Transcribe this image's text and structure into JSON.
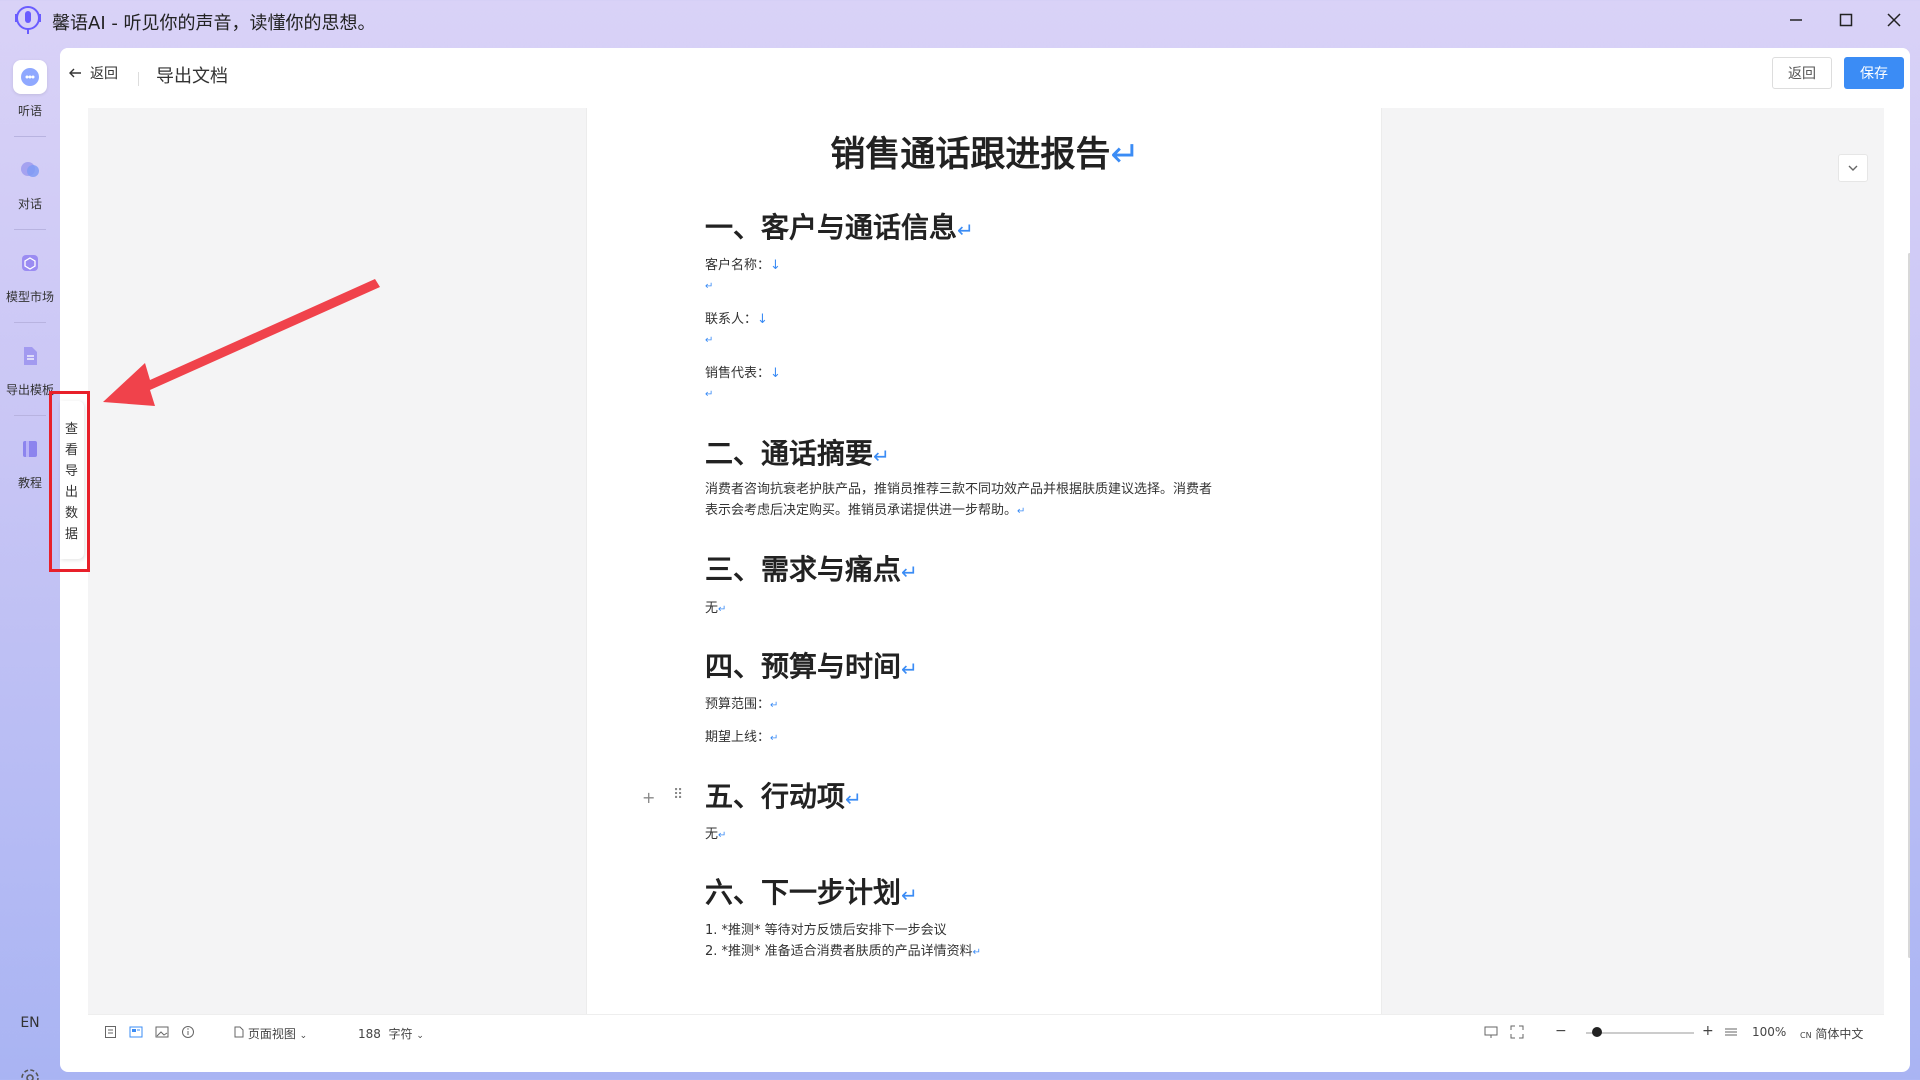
{
  "window": {
    "title": "馨语AI - 听见你的声音，读懂你的思想。",
    "min_icon": "minimize-icon",
    "max_icon": "maximize-icon",
    "close_icon": "close-icon"
  },
  "rail": {
    "items": [
      {
        "label": "听语",
        "icon": "ear-icon"
      },
      {
        "label": "对话",
        "icon": "chat-icon"
      },
      {
        "label": "模型市场",
        "icon": "cube-icon"
      },
      {
        "label": "导出模板",
        "icon": "document-icon"
      },
      {
        "label": "教程",
        "icon": "book-icon"
      }
    ],
    "lang": "EN",
    "settings_icon": "gear-icon"
  },
  "header": {
    "back_label": "返回",
    "title": "导出文档",
    "return_button": "返回",
    "save_button": "保存"
  },
  "side_tab": {
    "label": "查看导出数据"
  },
  "document": {
    "title": "销售通话跟进报告",
    "sections": {
      "s1": {
        "heading": "一、客户与通话信息",
        "customer": "客户名称：",
        "contact": "联系人：",
        "rep": "销售代表："
      },
      "s2": {
        "heading": "二、通话摘要",
        "line1": "消费者咨询抗衰老护肤产品，推销员推荐三款不同功效产品并根据肤质建议选择。消费者",
        "line2": "表示会考虑后决定购买。推销员承诺提供进一步帮助。"
      },
      "s3": {
        "heading": "三、需求与痛点",
        "body": "无"
      },
      "s4": {
        "heading": "四、预算与时间",
        "budget": "预算范围：",
        "timeline": "期望上线："
      },
      "s5": {
        "heading": "五、行动项",
        "body": "无"
      },
      "s6": {
        "heading": "六、下一步计划",
        "item1": "1. *推测* 等待对方反馈后安排下一步会议",
        "item2": "2. *推测* 准备适合消费者肤质的产品详情资料"
      }
    },
    "para_mark": "↵",
    "break_mark": "↓"
  },
  "statusbar": {
    "view_mode": "页面视图",
    "char_count": "188",
    "char_unit": "字符",
    "zoom": "100%",
    "lang_prefix": "CN",
    "lang": "简体中文",
    "zoom_fraction": 0.1
  }
}
